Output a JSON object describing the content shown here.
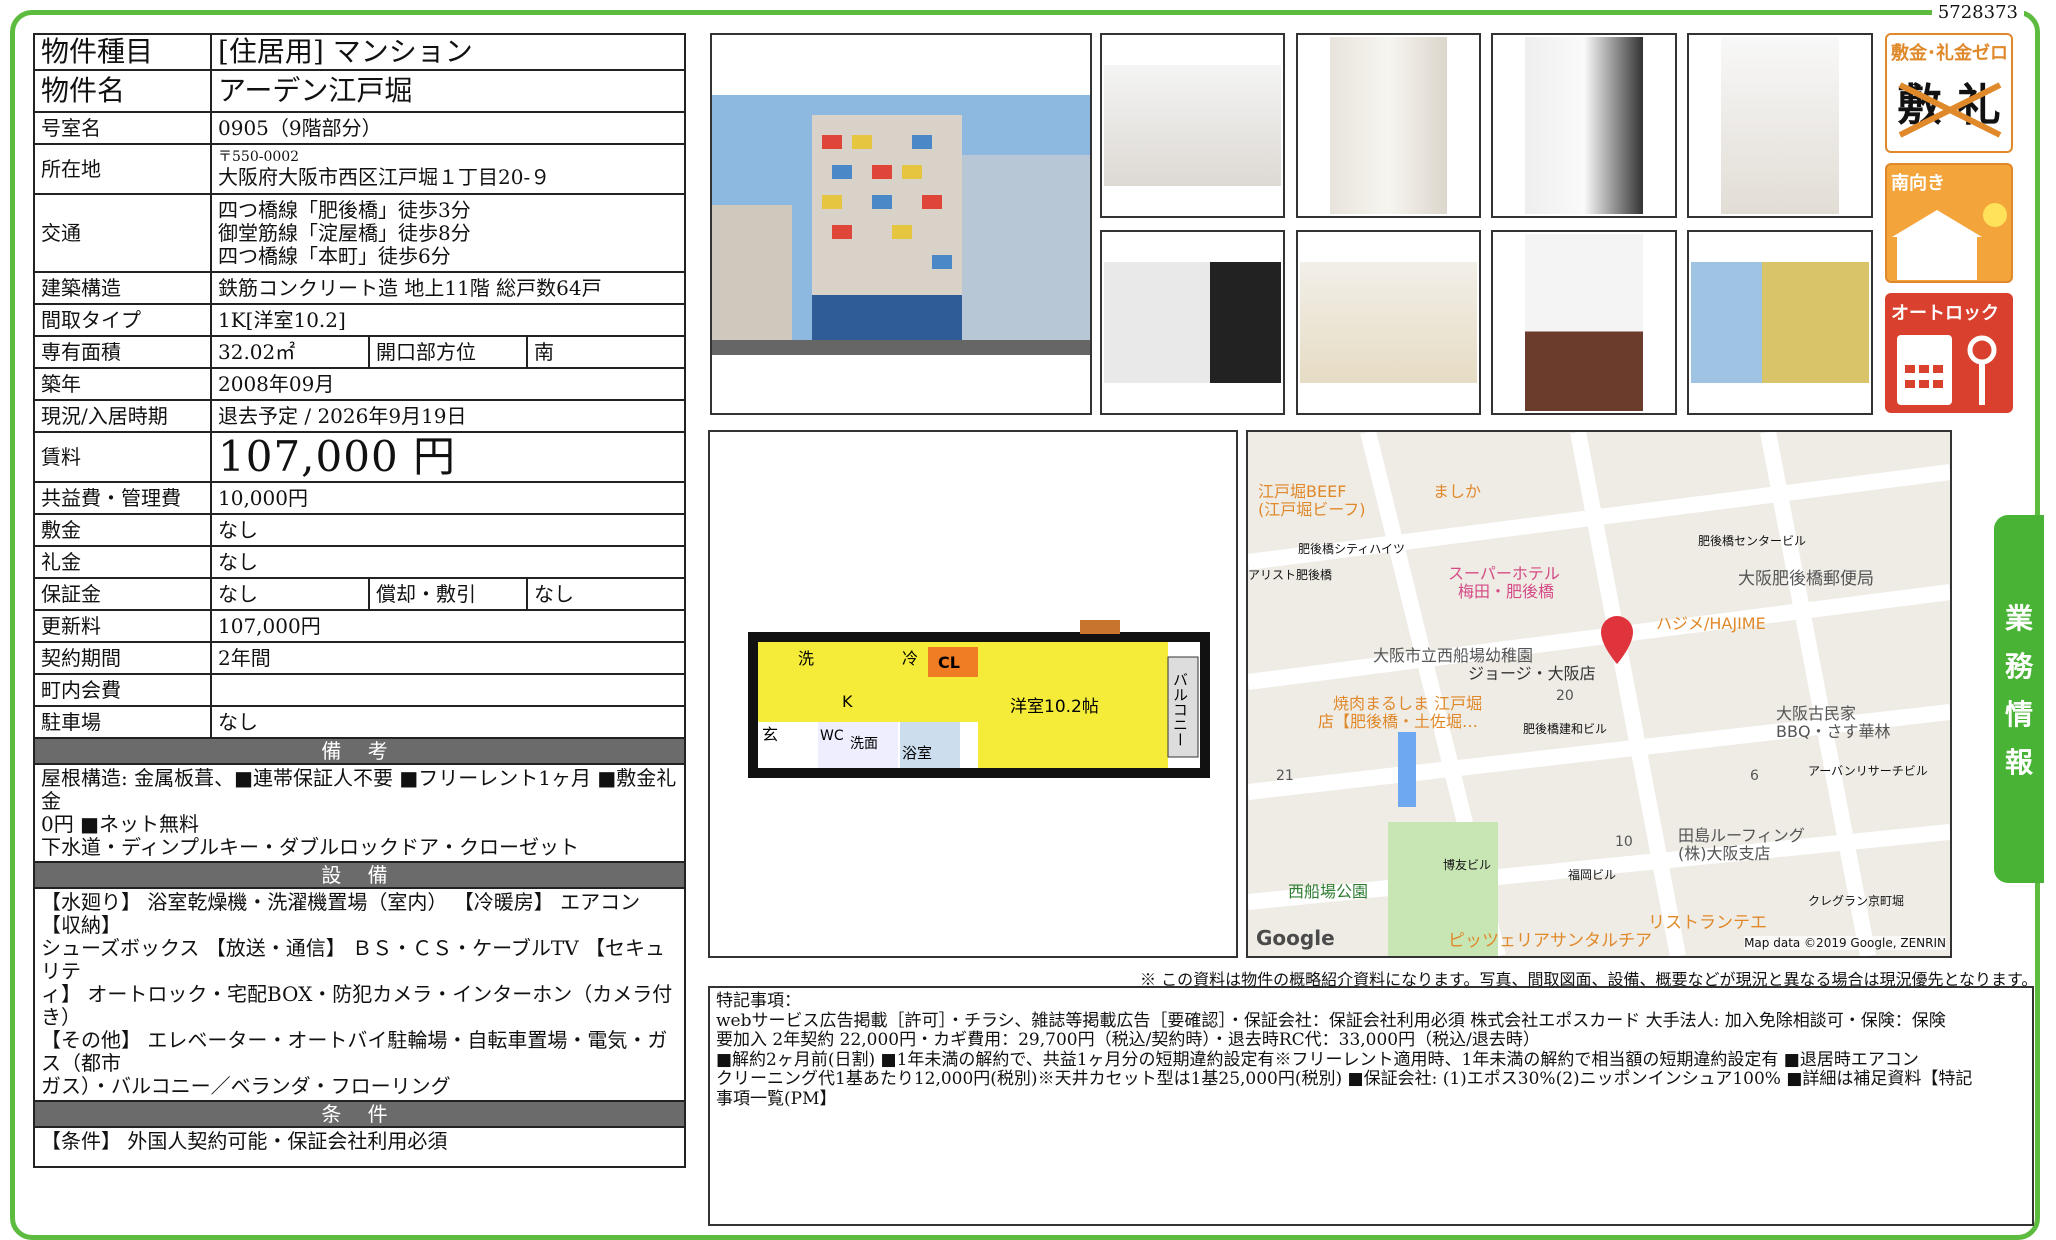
{
  "doc_id": "5728373",
  "spec": {
    "type_label": "物件種目",
    "type_value": "[住居用] マンション",
    "name_label": "物件名",
    "name_value": "アーデン江戸堀",
    "room_label": "号室名",
    "room_value": "0905（9階部分）",
    "address_label": "所在地",
    "postal": "〒550-0002",
    "address": "大阪府大阪市西区江戸堀１丁目20-９",
    "access_label": "交通",
    "access": [
      "四つ橋線「肥後橋」徒歩3分",
      "御堂筋線「淀屋橋」徒歩8分",
      "四つ橋線「本町」徒歩6分"
    ],
    "structure_label": "建築構造",
    "structure_value": "鉄筋コンクリート造 地上11階 総戸数64戸",
    "layout_label": "間取タイプ",
    "layout_value": "1K[洋室10.2]",
    "area_label": "専有面積",
    "area_value": "32.02㎡",
    "direction_label": "開口部方位",
    "direction_value": "南",
    "built_label": "築年",
    "built_value": "2008年09月",
    "status_label": "現況/入居時期",
    "status_value": "退去予定 / 2026年9月19日",
    "rent_label": "賃料",
    "rent_value": "107,000 円",
    "fee_label": "共益費・管理費",
    "fee_value": "10,000円",
    "deposit_label": "敷金",
    "deposit_value": "なし",
    "key_label": "礼金",
    "key_value": "なし",
    "guarantee_label": "保証金",
    "guarantee_value": "なし",
    "amort_label": "償却・敷引",
    "amort_value": "なし",
    "renew_label": "更新料",
    "renew_value": "107,000円",
    "term_label": "契約期間",
    "term_value": "2年間",
    "community_label": "町内会費",
    "community_value": "",
    "parking_label": "駐車場",
    "parking_value": "なし"
  },
  "sections": {
    "remarks_title": "備 考",
    "remarks_lines": [
      "屋根構造: 金属板葺、■連帯保証人不要 ■フリーレント1ヶ月 ■敷金礼金",
      "0円 ■ネット無料",
      "下水道・ディンプルキー・ダブルロックドア・クローゼット"
    ],
    "equipment_title": "設 備",
    "equipment_lines": [
      "【水廻り】 浴室乾燥機・洗濯機置場（室内） 【冷暖房】 エアコン 【収納】",
      "シューズボックス 【放送・通信】 ＢＳ・ＣＳ・ケーブルTV 【セキュリテ",
      "ィ】 オートロック・宅配BOX・防犯カメラ・インターホン（カメラ付き）",
      "【その他】 エレベーター・オートバイ駐輪場・自転車置場・電気・ガス（都市",
      "ガス）・バルコニー／ベランダ・フローリング"
    ],
    "conditions_title": "条 件",
    "conditions_lines": [
      "【条件】 外国人契約可能・保証会社利用必須"
    ]
  },
  "badges": [
    "敷金･礼金ゼロ",
    "南向き",
    "オートロック"
  ],
  "badge_glyphs": {
    "zero": "敷 礼"
  },
  "floorplan": {
    "wash": "洗",
    "fridge": "冷",
    "closet": "CL",
    "kitchen": "K",
    "room": "洋室10.2帖",
    "entrance": "玄",
    "wc": "WC",
    "basin": "洗面",
    "bath": "浴室",
    "balcony": "バルコニー"
  },
  "map": {
    "labels": [
      "江戸堀BEEF",
      "(江戸堀ビーフ)",
      "ましか",
      "肥後橋シティハイツ",
      "アリスト肥後橋",
      "スーパーホテル",
      "梅田・肥後橋",
      "肥後橋センタービル",
      "大阪肥後橋郵便局",
      "ハジメ/HAJIME",
      "大阪市立西船場幼稚園",
      "ジョージ・大阪店",
      "20",
      "焼肉まるしま 江戸堀",
      "店【肥後橋・土佐堀…",
      "肥後橋建和ビル",
      "大阪古民家",
      "BBQ・さす華林",
      "アーバンリサーチビル",
      "21",
      "6",
      "10",
      "田島ルーフィング",
      "(株)大阪支店",
      "博友ビル",
      "福岡ビル",
      "クレグラン京町堀",
      "西船場公園",
      "リストランテエ",
      "ピッツェリアサンタルチア"
    ],
    "google": "Google",
    "credit": "Map data ©2019 Google, ZENRIN"
  },
  "disclaimer": "※ この資料は物件の概略紹介資料になります。写真、間取図面、設備、概要などが現況と異なる場合は現況優先となります。",
  "special": {
    "title": "特記事項：",
    "lines": [
      "webサービス広告掲載［許可］・チラシ、雑誌等掲載広告［要確認］・保証会社：保証会社利用必須 株式会社エポスカード 大手法人: 加入免除相談可・保険：保険",
      "要加入 2年契約 22,000円・カギ費用：29,700円（税込/契約時）・退去時RC代：33,000円（税込/退去時）",
      "■解約2ヶ月前(日割) ■1年未満の解約で、共益1ヶ月分の短期違約設定有※フリーレント適用時、1年未満の解約で相当額の短期違約設定有 ■退居時エアコン",
      "クリーニング代1基あたり12,000円(税別)※天井カセット型は1基25,000円(税別) ■保証会社: (1)エポス30%(2)ニッポンインシュア100% ■詳細は補足資料【特記",
      "事項一覧(PM】"
    ]
  },
  "side_tab": [
    "業",
    "務",
    "情",
    "報"
  ],
  "colors": {
    "frame": "#5dbb3f",
    "badge": "#e0892b",
    "section": "#6b6b6b",
    "tab": "#48b335",
    "pin": "#e0343c",
    "plan_yellow": "#f5ec3a",
    "plan_orange": "#f07c24"
  }
}
